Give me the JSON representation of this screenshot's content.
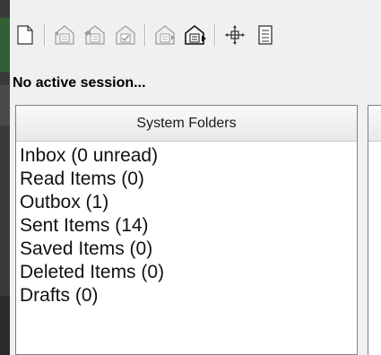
{
  "toolbar": {
    "buttons": [
      {
        "name": "new-message-icon"
      },
      {
        "name": "reply-icon"
      },
      {
        "name": "reply-all-icon"
      },
      {
        "name": "mark-read-icon"
      },
      {
        "name": "forward-icon"
      },
      {
        "name": "send-receive-icon"
      },
      {
        "name": "move-icon"
      },
      {
        "name": "properties-icon"
      }
    ]
  },
  "session": {
    "status": "No active session..."
  },
  "folders": {
    "header": "System Folders",
    "items": [
      {
        "label": "Inbox  (0 unread)"
      },
      {
        "label": "Read Items  (0)"
      },
      {
        "label": "Outbox  (1)"
      },
      {
        "label": "Sent Items  (14)"
      },
      {
        "label": "Saved Items  (0)"
      },
      {
        "label": "Deleted Items  (0)"
      },
      {
        "label": "Drafts  (0)"
      }
    ]
  }
}
